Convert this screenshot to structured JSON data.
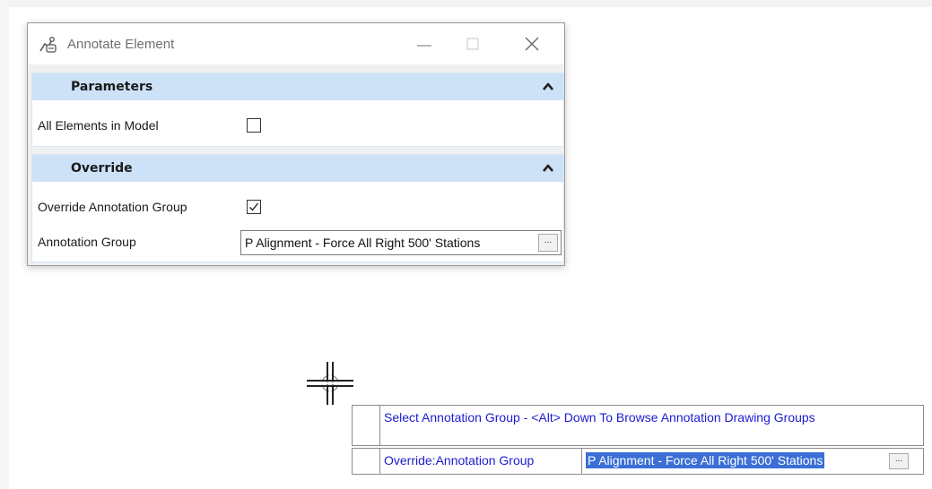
{
  "dialog": {
    "title": "Annotate Element",
    "icons": {
      "app": "annotate-element-icon",
      "minimize": "minimize-icon",
      "maximize": "maximize-icon",
      "close": "close-icon"
    },
    "sections": {
      "parameters": {
        "title": "Parameters",
        "toggle_icon": "chevron-up-icon",
        "all_elements_label": "All Elements in Model",
        "all_elements_checked": false
      },
      "override": {
        "title": "Override",
        "toggle_icon": "chevron-up-icon",
        "override_group_label": "Override Annotation Group",
        "override_group_checked": true,
        "annotation_group_label": "Annotation Group",
        "annotation_group_value": "P Alignment - Force All Right 500' Stations",
        "browse_label": "..."
      }
    }
  },
  "prompt": {
    "message": "Select Annotation Group - <Alt> Down To Browse Annotation Drawing Groups",
    "input_label": "Override:Annotation Group",
    "input_value": "P Alignment - Force All Right 500' Stations",
    "browse_label": "..."
  },
  "cursor": {
    "icon": "crosshair-cursor-icon"
  }
}
